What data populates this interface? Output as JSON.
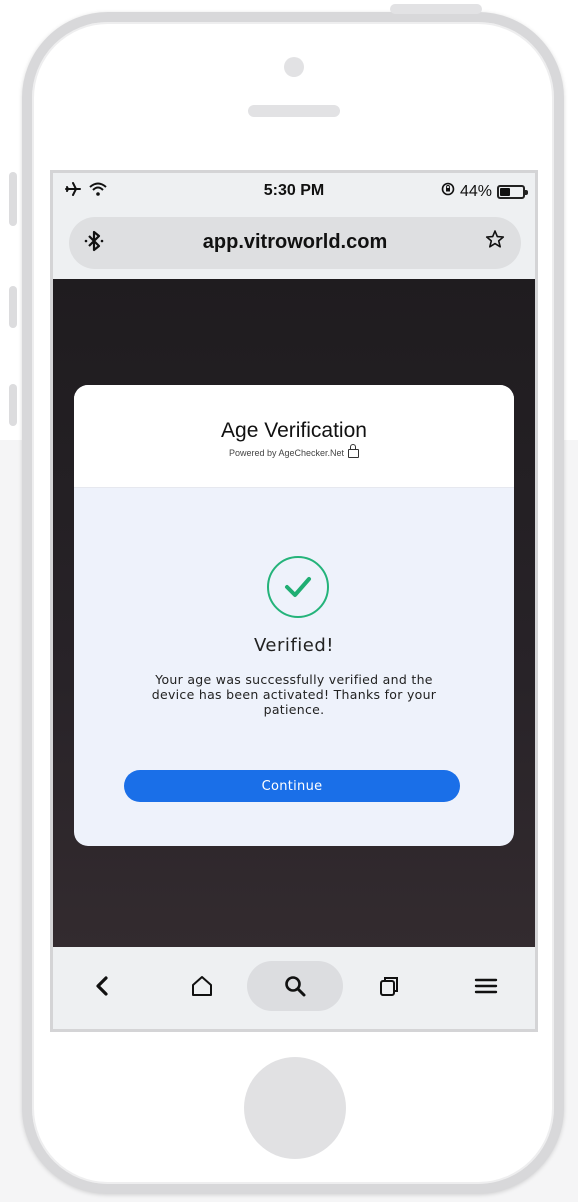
{
  "status_bar": {
    "time": "5:30 PM",
    "battery_percent": "44%",
    "battery_level": 0.44
  },
  "browser": {
    "url": "app.vitroworld.com"
  },
  "modal": {
    "title": "Age Verification",
    "powered_by": "Powered by AgeChecker.Net",
    "status_title": "Verified!",
    "message": "Your age was successfully verified and the device has been activated! Thanks for your patience.",
    "continue_label": "Continue"
  },
  "colors": {
    "accent_blue": "#1a6fe8",
    "success_green": "#24b37a"
  },
  "icons": {
    "status_left": [
      "airplane-icon",
      "wifi-icon"
    ],
    "status_right": [
      "orientation-lock-icon",
      "battery-icon"
    ],
    "url_left": "bluetooth-icon",
    "url_right": "star-icon",
    "bottom_nav": [
      "back-icon",
      "home-icon",
      "search-icon",
      "tabs-icon",
      "menu-icon"
    ]
  }
}
